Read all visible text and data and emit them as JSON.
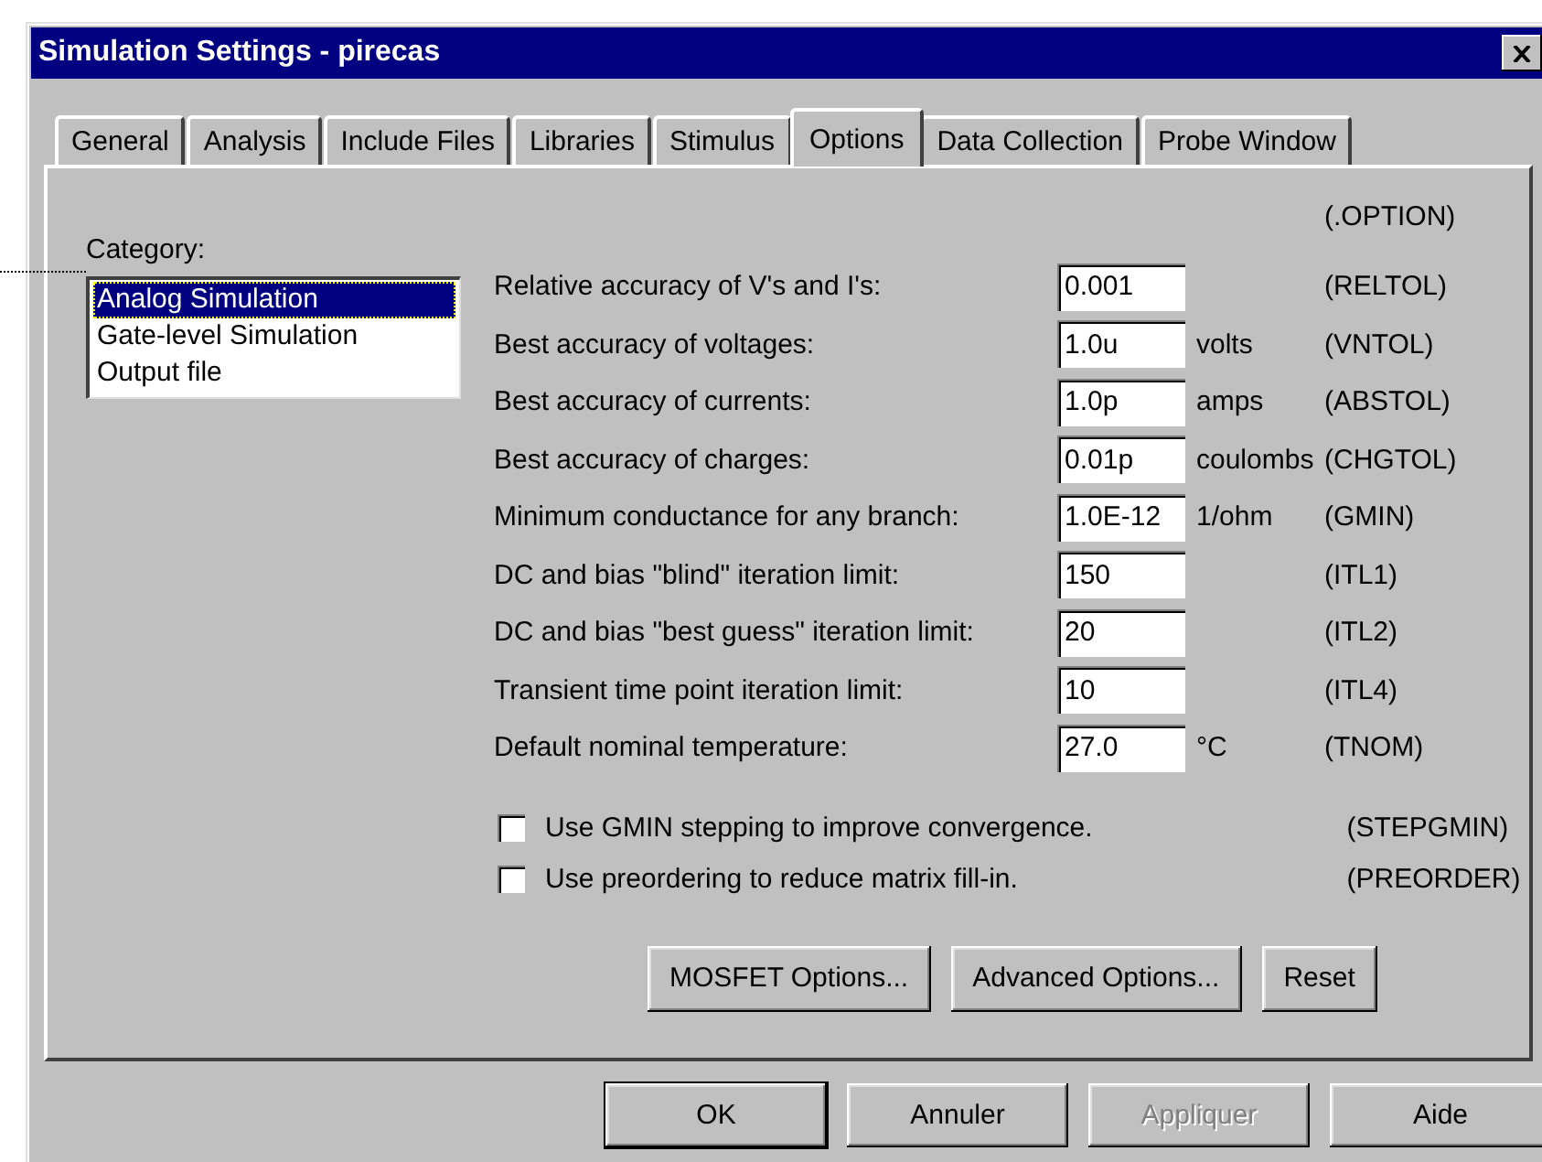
{
  "window": {
    "title": "Simulation Settings - pirecas"
  },
  "tabs": [
    {
      "label": "General",
      "selected": false
    },
    {
      "label": "Analysis",
      "selected": false
    },
    {
      "label": "Include Files",
      "selected": false
    },
    {
      "label": "Libraries",
      "selected": false
    },
    {
      "label": "Stimulus",
      "selected": false
    },
    {
      "label": "Options",
      "selected": true
    },
    {
      "label": "Data Collection",
      "selected": false
    },
    {
      "label": "Probe Window",
      "selected": false
    }
  ],
  "category": {
    "label": "Category:",
    "items": [
      {
        "label": "Analog Simulation",
        "selected": true
      },
      {
        "label": "Gate-level Simulation",
        "selected": false
      },
      {
        "label": "Output file",
        "selected": false
      }
    ]
  },
  "option_header": "(.OPTION)",
  "parameters": [
    {
      "label": "Relative accuracy of V's and I's:",
      "value": "0.001",
      "code": "(RELTOL)"
    },
    {
      "label": "Best accuracy of voltages:",
      "value": "1.0u",
      "unit": "volts",
      "code": "(VNTOL)"
    },
    {
      "label": "Best accuracy of currents:",
      "value": "1.0p",
      "unit": "amps",
      "code": "(ABSTOL)"
    },
    {
      "label": "Best accuracy of charges:",
      "value": "0.01p",
      "unit": "coulombs",
      "code": "(CHGTOL)"
    },
    {
      "label": "Minimum conductance for any branch:",
      "value": "1.0E-12",
      "unit": "1/ohm",
      "code": "(GMIN)"
    },
    {
      "label": "DC and bias \"blind\" iteration limit:",
      "value": "150",
      "code": "(ITL1)"
    },
    {
      "label": "DC and bias \"best guess\" iteration limit:",
      "value": "20",
      "code": "(ITL2)"
    },
    {
      "label": "Transient time point iteration limit:",
      "value": "10",
      "code": "(ITL4)"
    },
    {
      "label": "Default nominal temperature:",
      "value": "27.0",
      "unit": "°C",
      "code": "(TNOM)"
    }
  ],
  "checkboxes": [
    {
      "label": "Use GMIN stepping to improve convergence.",
      "checked": false,
      "code": "(STEPGMIN)"
    },
    {
      "label": "Use preordering to reduce matrix fill-in.",
      "checked": false,
      "code": "(PREORDER)"
    }
  ],
  "option_buttons": [
    {
      "label": "MOSFET Options..."
    },
    {
      "label": "Advanced Options..."
    },
    {
      "label": "Reset"
    }
  ],
  "dialog_buttons": [
    {
      "label": "OK",
      "default": true,
      "disabled": false
    },
    {
      "label": "Annuler",
      "default": false,
      "disabled": false
    },
    {
      "label": "Appliquer",
      "default": false,
      "disabled": true
    },
    {
      "label": "Aide",
      "default": false,
      "disabled": false
    }
  ]
}
